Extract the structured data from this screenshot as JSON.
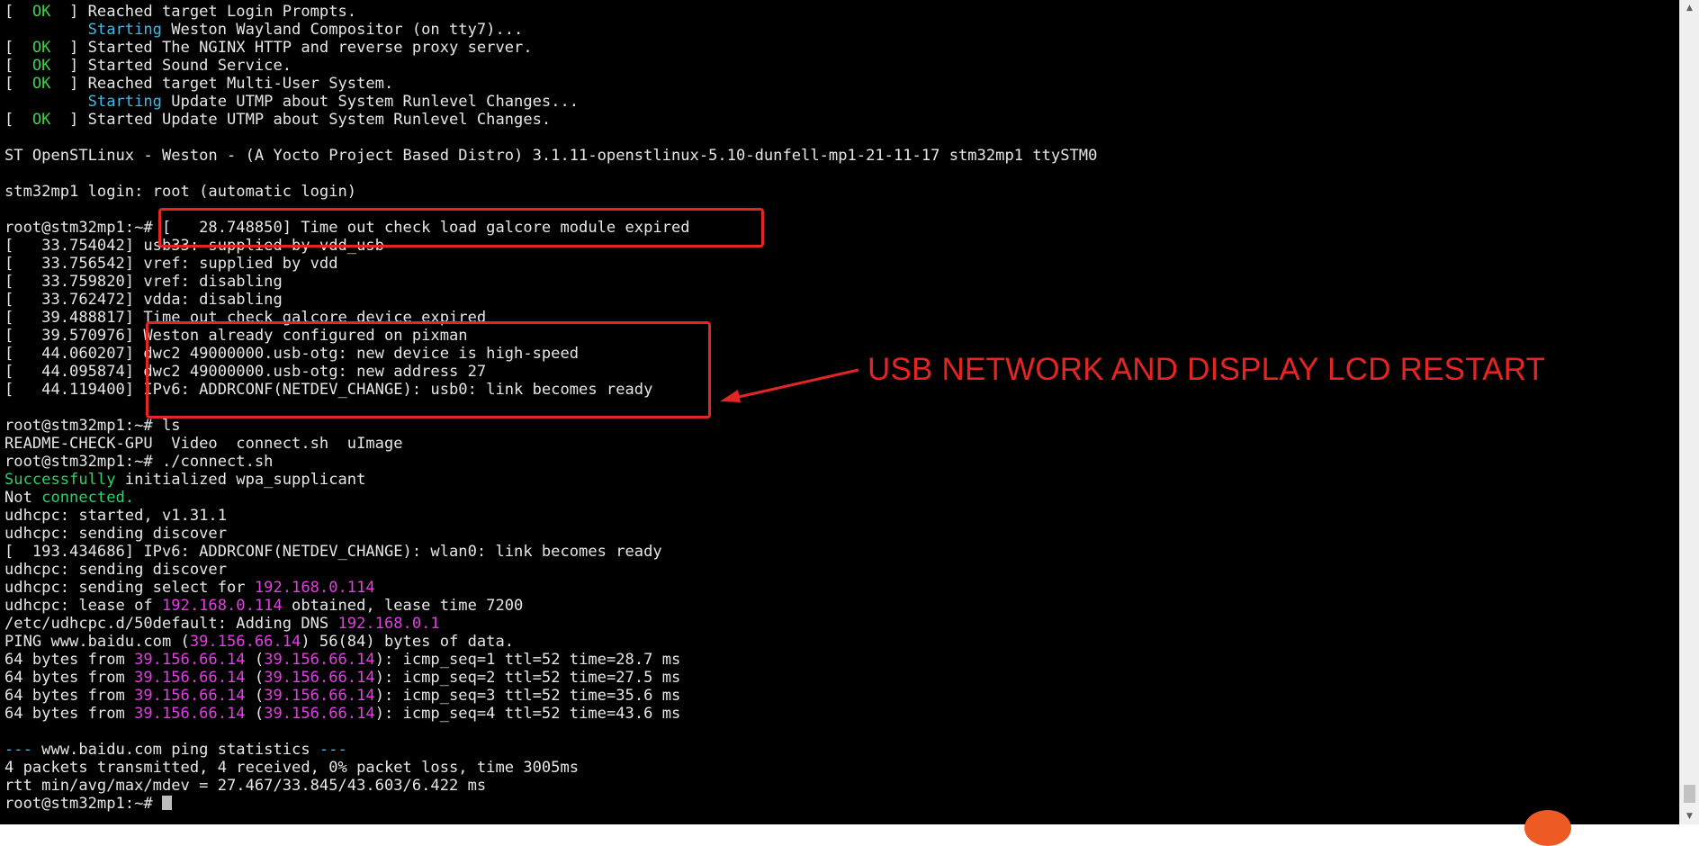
{
  "terminal": {
    "lines": [
      [
        {
          "t": "[  "
        },
        {
          "t": "OK",
          "c": "ok"
        },
        {
          "t": "  ] Reached target Login Prompts."
        }
      ],
      [
        {
          "t": "         "
        },
        {
          "t": "Starting",
          "c": "starting"
        },
        {
          "t": " Weston Wayland Compositor (on tty7)..."
        }
      ],
      [
        {
          "t": "[  "
        },
        {
          "t": "OK",
          "c": "ok"
        },
        {
          "t": "  ] Started The NGINX HTTP and reverse proxy server."
        }
      ],
      [
        {
          "t": "[  "
        },
        {
          "t": "OK",
          "c": "ok"
        },
        {
          "t": "  ] Started Sound Service."
        }
      ],
      [
        {
          "t": "[  "
        },
        {
          "t": "OK",
          "c": "ok"
        },
        {
          "t": "  ] Reached target Multi-User System."
        }
      ],
      [
        {
          "t": "         "
        },
        {
          "t": "Starting",
          "c": "starting"
        },
        {
          "t": " Update UTMP about System Runlevel Changes..."
        }
      ],
      [
        {
          "t": "[  "
        },
        {
          "t": "OK",
          "c": "ok"
        },
        {
          "t": "  ] Started Update UTMP about System Runlevel Changes."
        }
      ],
      [],
      [
        {
          "t": "ST OpenSTLinux - Weston - (A Yocto Project Based Distro) 3.1.11-openstlinux-5.10-dunfell-mp1-21-11-17 stm32mp1 ttySTM0"
        }
      ],
      [],
      [
        {
          "t": "stm32mp1 login: root (automatic login)"
        }
      ],
      [],
      [
        {
          "t": "root@stm32mp1:~# [   28.748850] Time out check load galcore module expired"
        }
      ],
      [
        {
          "t": "[   33.754042] usb33: supplied by vdd_usb"
        }
      ],
      [
        {
          "t": "[   33.756542] vref: supplied by vdd"
        }
      ],
      [
        {
          "t": "[   33.759820] vref: disabling"
        }
      ],
      [
        {
          "t": "[   33.762472] vdda: disabling"
        }
      ],
      [
        {
          "t": "[   39.488817] Time out check galcore device expired"
        }
      ],
      [
        {
          "t": "[   39.570976] Weston already configured on pixman"
        }
      ],
      [
        {
          "t": "[   44.060207] dwc2 49000000.usb-otg: new device is high-speed"
        }
      ],
      [
        {
          "t": "[   44.095874] dwc2 49000000.usb-otg: new address 27"
        }
      ],
      [
        {
          "t": "[   44.119400] IPv6: ADDRCONF(NETDEV_CHANGE): usb0: link becomes ready"
        }
      ],
      [],
      [
        {
          "t": "root@stm32mp1:~# ls"
        }
      ],
      [
        {
          "t": "README-CHECK-GPU  Video  connect.sh  uImage"
        }
      ],
      [
        {
          "t": "root@stm32mp1:~# ./connect.sh"
        }
      ],
      [
        {
          "t": "Successfully",
          "c": "success"
        },
        {
          "t": " initialized wpa_supplicant"
        }
      ],
      [
        {
          "t": "Not "
        },
        {
          "t": "connected.",
          "c": "success"
        }
      ],
      [
        {
          "t": "udhcpc: started, v1.31.1"
        }
      ],
      [
        {
          "t": "udhcpc: sending discover"
        }
      ],
      [
        {
          "t": "[  193.434686] IPv6: ADDRCONF(NETDEV_CHANGE): wlan0: link becomes ready"
        }
      ],
      [
        {
          "t": "udhcpc: sending discover"
        }
      ],
      [
        {
          "t": "udhcpc: sending select for "
        },
        {
          "t": "192.168.0.114",
          "c": "ip"
        }
      ],
      [
        {
          "t": "udhcpc: lease of "
        },
        {
          "t": "192.168.0.114",
          "c": "ip"
        },
        {
          "t": " obtained, lease time 7200"
        }
      ],
      [
        {
          "t": "/etc/udhcpc.d/50default: Adding DNS "
        },
        {
          "t": "192.168.0.1",
          "c": "ip"
        }
      ],
      [
        {
          "t": "PING www.baidu.com ("
        },
        {
          "t": "39.156.66.14",
          "c": "ip"
        },
        {
          "t": ") 56(84) bytes of data."
        }
      ],
      [
        {
          "t": "64 bytes from "
        },
        {
          "t": "39.156.66.14",
          "c": "ip"
        },
        {
          "t": " ("
        },
        {
          "t": "39.156.66.14",
          "c": "ip"
        },
        {
          "t": "): icmp_seq=1 ttl=52 time=28.7 ms"
        }
      ],
      [
        {
          "t": "64 bytes from "
        },
        {
          "t": "39.156.66.14",
          "c": "ip"
        },
        {
          "t": " ("
        },
        {
          "t": "39.156.66.14",
          "c": "ip"
        },
        {
          "t": "): icmp_seq=2 ttl=52 time=27.5 ms"
        }
      ],
      [
        {
          "t": "64 bytes from "
        },
        {
          "t": "39.156.66.14",
          "c": "ip"
        },
        {
          "t": " ("
        },
        {
          "t": "39.156.66.14",
          "c": "ip"
        },
        {
          "t": "): icmp_seq=3 ttl=52 time=35.6 ms"
        }
      ],
      [
        {
          "t": "64 bytes from "
        },
        {
          "t": "39.156.66.14",
          "c": "ip"
        },
        {
          "t": " ("
        },
        {
          "t": "39.156.66.14",
          "c": "ip"
        },
        {
          "t": "): icmp_seq=4 ttl=52 time=43.6 ms"
        }
      ],
      [],
      [
        {
          "t": "--- ",
          "c": "dashes"
        },
        {
          "t": "www.baidu.com ping statistics"
        },
        {
          "t": " ---",
          "c": "dashes"
        }
      ],
      [
        {
          "t": "4 packets transmitted, 4 received, 0% packet loss, time 3005ms"
        }
      ],
      [
        {
          "t": "rtt min/avg/max/mdev = 27.467/33.845/43.603/6.422 ms"
        }
      ],
      [
        {
          "t": "root@stm32mp1:~# "
        },
        {
          "t": "",
          "c": "cursor"
        }
      ]
    ]
  },
  "annotation": {
    "label": "USB NETWORK AND DISPLAY LCD RESTART"
  },
  "colors": {
    "background": "#000000",
    "text": "#e6e6e6",
    "ok": "#3fcf4f",
    "starting": "#3eb8e6",
    "success": "#2ed06a",
    "ip": "#e040e0",
    "annotation": "#e52424"
  },
  "icons": {
    "scroll_up": "triangle-up-icon",
    "scroll_down": "triangle-down-icon",
    "corner_logo": "app-logo-icon"
  }
}
